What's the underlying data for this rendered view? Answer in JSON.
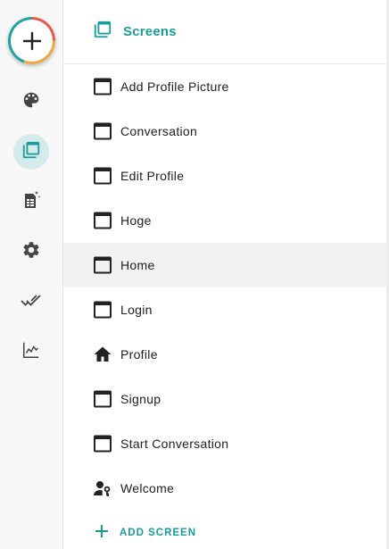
{
  "header": {
    "title": "Screens"
  },
  "rail": {
    "items": [
      {
        "name": "theme",
        "icon": "palette-icon"
      },
      {
        "name": "screens",
        "icon": "screens-icon",
        "active": true
      },
      {
        "name": "data",
        "icon": "data-sheet-icon"
      },
      {
        "name": "settings",
        "icon": "gear-icon"
      },
      {
        "name": "tests",
        "icon": "double-check-icon"
      },
      {
        "name": "analytics",
        "icon": "line-chart-icon"
      }
    ]
  },
  "screens": [
    {
      "label": "Add Profile Picture",
      "icon": "window-icon"
    },
    {
      "label": "Conversation",
      "icon": "window-icon"
    },
    {
      "label": "Edit Profile",
      "icon": "window-icon"
    },
    {
      "label": "Hoge",
      "icon": "window-icon"
    },
    {
      "label": "Home",
      "icon": "window-icon",
      "selected": true
    },
    {
      "label": "Login",
      "icon": "window-icon"
    },
    {
      "label": "Profile",
      "icon": "home-icon"
    },
    {
      "label": "Signup",
      "icon": "window-icon"
    },
    {
      "label": "Start Conversation",
      "icon": "window-icon"
    },
    {
      "label": "Welcome",
      "icon": "user-key-icon"
    }
  ],
  "add_screen": {
    "label": "ADD SCREEN"
  },
  "colors": {
    "accent": "#1a9c9c",
    "rail_active_bg": "#d5ebeb",
    "selected_row_bg": "#f2f2f2"
  }
}
